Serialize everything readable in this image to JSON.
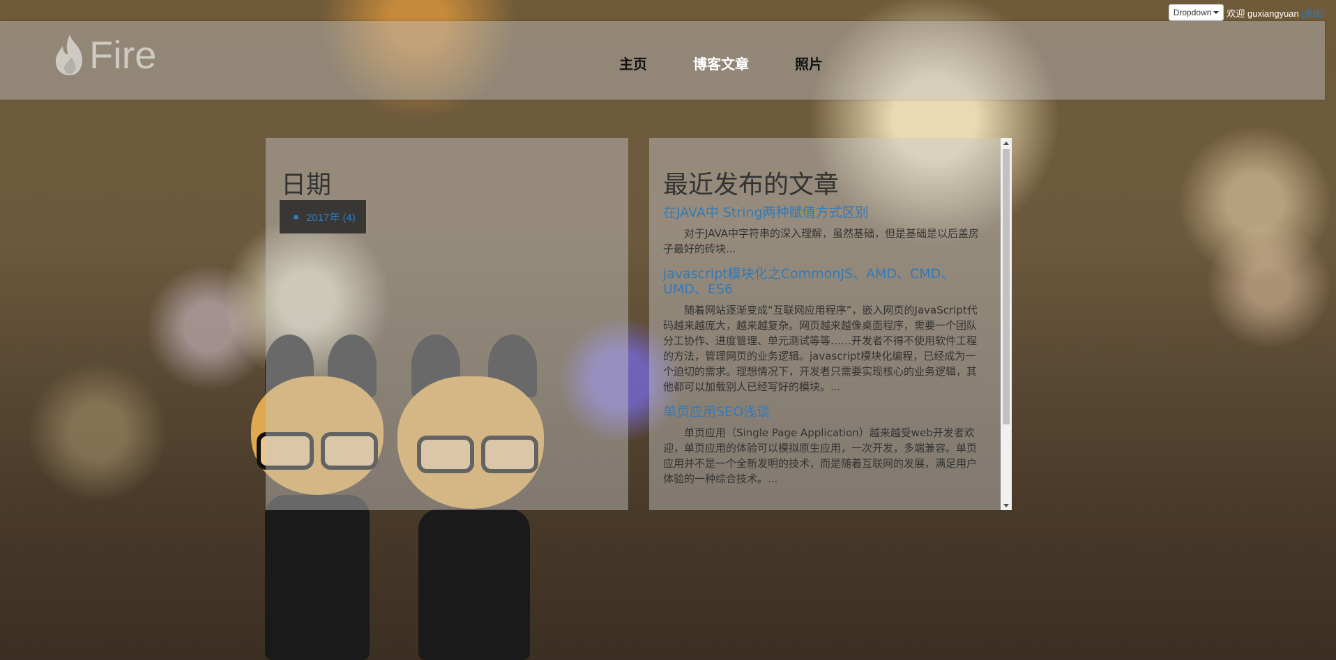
{
  "userbar": {
    "dropdown_label": "Dropdown",
    "welcome_text": "欢迎 guxiangyuan",
    "logout_label": "[退出]"
  },
  "header": {
    "logo_text": "Fire",
    "logo_icon": "flame-icon"
  },
  "nav": {
    "items": [
      {
        "label": "主页",
        "active": false
      },
      {
        "label": "博客文章",
        "active": true
      },
      {
        "label": "照片",
        "active": false
      }
    ]
  },
  "dates_panel": {
    "title": "日期",
    "items": [
      {
        "label": "2017年 (4)"
      }
    ]
  },
  "articles_panel": {
    "title": "最近发布的文章",
    "articles": [
      {
        "title": "在JAVA中 String两种赋值方式区别",
        "summary": "对于JAVA中字符串的深入理解，虽然基础，但是基础是以后盖房子最好的砖块..."
      },
      {
        "title": "javascript模块化之CommonJS、AMD、CMD、UMD、ES6",
        "summary": "随着网站逐渐变成“互联网应用程序”，嵌入网页的JavaScript代码越来越庞大，越来越复杂。网页越来越像桌面程序，需要一个团队分工协作、进度管理、单元测试等等……开发者不得不使用软件工程的方法，管理网页的业务逻辑。javascript模块化编程，已经成为一个迫切的需求。理想情况下，开发者只需要实现核心的业务逻辑，其他都可以加载别人已经写好的模块。..."
      },
      {
        "title": "单页应用SEO浅谈",
        "summary": "单页应用（Single Page Application）越来越受web开发者欢迎，单页应用的体验可以模拟原生应用，一次开发，多端兼容。单页应用并不是一个全新发明的技术，而是随着互联网的发展，满足用户体验的一种综合技术。..."
      }
    ]
  },
  "colors": {
    "link": "#337ab7",
    "nav_active": "#ffffff",
    "nav_default": "#111111"
  }
}
